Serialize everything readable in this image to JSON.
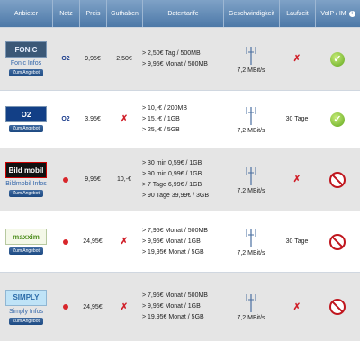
{
  "header": {
    "provider": "Anbieter",
    "network": "Netz",
    "price": "Preis",
    "credit": "Guthaben",
    "tariffs": "Datentarife",
    "speed": "Geschwindigkeit",
    "duration": "Laufzeit",
    "voip": "VoIP / IM"
  },
  "rows": [
    {
      "logo_text": "FONIC",
      "provider_link": "Fonic Infos",
      "button": "Zum Angebot",
      "network": "O2",
      "price": "9,95€",
      "credit": "2,50€",
      "tariffs": [
        "> 2,50€ Tag / 500MB",
        "> 9,95€ Monat / 500MB"
      ],
      "speed": "7,2 MBit/s",
      "duration_text": "",
      "duration_icon": "cross-icon",
      "voip_icon": "check-icon"
    },
    {
      "logo_text": "O2",
      "provider_link": "",
      "button": "Zum Angebot",
      "network": "O2",
      "price": "3,95€",
      "credit_icon": "cross-icon",
      "tariffs": [
        "> 10,-€ / 200MB",
        "> 15,-€ / 1GB",
        "> 25,-€ / 5GB"
      ],
      "speed": "7,2 MBit/s",
      "duration_text": "30 Tage",
      "voip_icon": "check-icon"
    },
    {
      "logo_text": "Bild mobil",
      "provider_link": "Bildmobil Infos",
      "button": "Zum Angebot",
      "network": "vodafone",
      "price": "9,95€",
      "credit": "10,-€",
      "tariffs": [
        "> 30 min 0,59€ / 1GB",
        "> 90 min 0,99€ / 1GB",
        "> 7 Tage 6,99€ / 1GB",
        "> 90 Tage 39,99€ / 3GB"
      ],
      "speed": "7,2 MBit/s",
      "duration_text": "",
      "duration_icon": "cross-icon",
      "voip_icon": "no-icon"
    },
    {
      "logo_text": "maxxim",
      "provider_link": "",
      "button": "Zum Angebot",
      "network": "vodafone",
      "price": "24,95€",
      "credit_icon": "cross-icon",
      "tariffs": [
        "> 7,95€ Monat / 500MB",
        "> 9,95€ Monat / 1GB",
        "> 19,95€ Monat / 5GB"
      ],
      "speed": "7,2 MBit/s",
      "duration_text": "30 Tage",
      "voip_icon": "no-icon"
    },
    {
      "logo_text": "SIMPLY",
      "provider_link": "Simply Infos",
      "button": "Zum Angebot",
      "network": "vodafone",
      "price": "24,95€",
      "credit_icon": "cross-icon",
      "tariffs": [
        "> 7,95€ Monat / 500MB",
        "> 9,95€ Monat / 1GB",
        "> 19,95€ Monat / 5GB"
      ],
      "speed": "7,2 MBit/s",
      "duration_icon": "cross-icon",
      "voip_icon": "no-icon"
    }
  ]
}
